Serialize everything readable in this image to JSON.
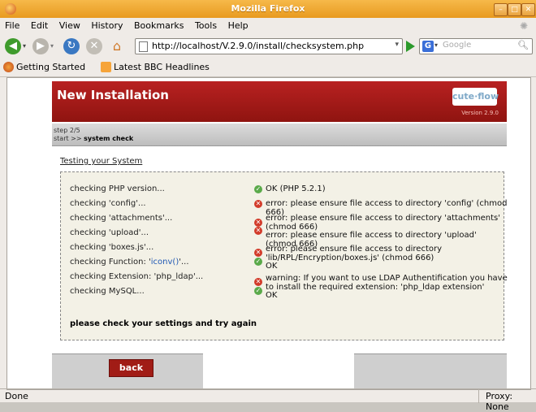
{
  "window": {
    "title": "Mozilla Firefox"
  },
  "menu": [
    "File",
    "Edit",
    "View",
    "History",
    "Bookmarks",
    "Tools",
    "Help"
  ],
  "nav": {
    "url": "http://localhost/V.2.9.0/install/checksystem.php",
    "search_placeholder": "Google"
  },
  "bookmarks": [
    "Getting Started",
    "Latest BBC Headlines"
  ],
  "page": {
    "header_title": "New Installation",
    "logo_text": "cute·flow",
    "logo_version": "Version 2.9.0",
    "step": "step 2/5",
    "breadcrumb_prefix": "start >> ",
    "breadcrumb_current": "system check",
    "section_title": "Testing your System",
    "checks": [
      {
        "label": "checking PHP version...",
        "status": "ok",
        "result": "OK (PHP 5.2.1)"
      },
      {
        "label": "checking 'config'...",
        "status": "error",
        "result": "error: please ensure file access to directory 'config' (chmod 666)"
      },
      {
        "label": "checking 'attachments'...",
        "status": "error",
        "result": "error: please ensure file access to directory 'attachments' (chmod 666)"
      },
      {
        "label": "checking 'upload'...",
        "status": "error",
        "result": "error: please ensure file access to directory 'upload' (chmod 666)"
      },
      {
        "label": "checking 'boxes.js'...",
        "status": "error",
        "result": "error: please ensure file access to directory 'lib/RPL/Encryption/boxes.js' (chmod 666)"
      },
      {
        "label_prefix": "checking Function: '",
        "label_fn": "iconv()",
        "label_suffix": "'...",
        "status": "ok",
        "result": "OK"
      },
      {
        "label": "checking Extension: 'php_ldap'...",
        "status": "error",
        "result": "warning: If you want to use LDAP Authentification you have to install the required extension: 'php_ldap extension'"
      },
      {
        "label": "checking MySQL...",
        "status": "ok",
        "result": "OK"
      }
    ],
    "final_message": "please check your settings and try again",
    "back_label": "back"
  },
  "status": {
    "text": "Done",
    "proxy": "Proxy: None"
  }
}
